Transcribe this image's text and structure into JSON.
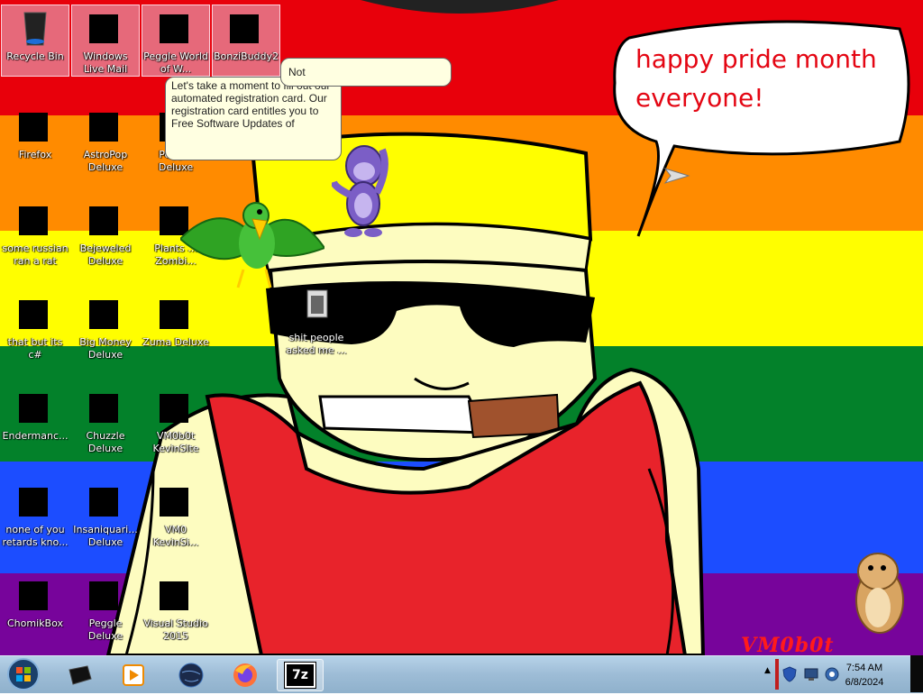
{
  "colors": {
    "red": "#e8000b",
    "orange": "#ff8b00",
    "yellow": "#fffe00",
    "green": "#03812a",
    "blue": "#1c4dff",
    "purple": "#77049b",
    "skin": "#fdfcc0",
    "shirt": "#e8232b",
    "speech_text": "#e40613"
  },
  "desktop": {
    "icons": [
      {
        "label": "Recycle Bin",
        "icon": "recycle-bin-icon"
      },
      {
        "label": "Windows Live Mail",
        "icon": "mail-icon"
      },
      {
        "label": "Peggle World of W...",
        "icon": "peggle-icon"
      },
      {
        "label": "BonziBuddy2",
        "icon": "folder-icon"
      },
      {
        "label": "Firefox",
        "icon": "firefox-icon"
      },
      {
        "label": "AstroPop Deluxe",
        "icon": "astropop-icon"
      },
      {
        "label": "Pegg... Deluxe",
        "icon": "peggle-nights-icon"
      },
      {
        "label": "some russian ran a rat",
        "icon": "app-icon"
      },
      {
        "label": "Bejeweled Deluxe",
        "icon": "bejeweled-icon"
      },
      {
        "label": "Plants ... Zombi...",
        "icon": "pvz-icon"
      },
      {
        "label": "that but its c#",
        "icon": "file-icon"
      },
      {
        "label": "Big Money Deluxe",
        "icon": "money-bag-icon"
      },
      {
        "label": "Zuma Deluxe",
        "icon": "zuma-icon"
      },
      {
        "label": "Endermanc...",
        "icon": "app-icon"
      },
      {
        "label": "Chuzzle Deluxe",
        "icon": "chuzzle-icon"
      },
      {
        "label": "VM0b0t KevinSite",
        "icon": "site-icon"
      },
      {
        "label": "none of you retards kno...",
        "icon": "app-icon"
      },
      {
        "label": "Insaniquari... Deluxe",
        "icon": "insaniquarium-icon"
      },
      {
        "label": "VM0 KevinSi...",
        "icon": "site-icon"
      },
      {
        "label": "ChomikBox",
        "icon": "chomikbox-icon"
      },
      {
        "label": "Peggle Deluxe",
        "icon": "peggle-icon"
      },
      {
        "label": "Visual Studio 2015",
        "icon": "visual-studio-icon"
      },
      {
        "label": "shit people asked me ...",
        "icon": "text-file-icon"
      }
    ],
    "speech_bubble": "happy pride month everyone!",
    "registration_bubble": "Let's take a moment to fill out our automated registration card. Our registration card entitles you to Free Software Updates of",
    "not_bubble": "Not",
    "watermark": "VM0b0t"
  },
  "taskbar": {
    "start": "start-orb",
    "buttons": [
      "terminal-icon",
      "media-player-icon",
      "globe-icon",
      "firefox-icon",
      "7zip-icon"
    ],
    "seven_zip_label": "7z",
    "time": "7:54 AM",
    "date": "6/8/2024"
  }
}
